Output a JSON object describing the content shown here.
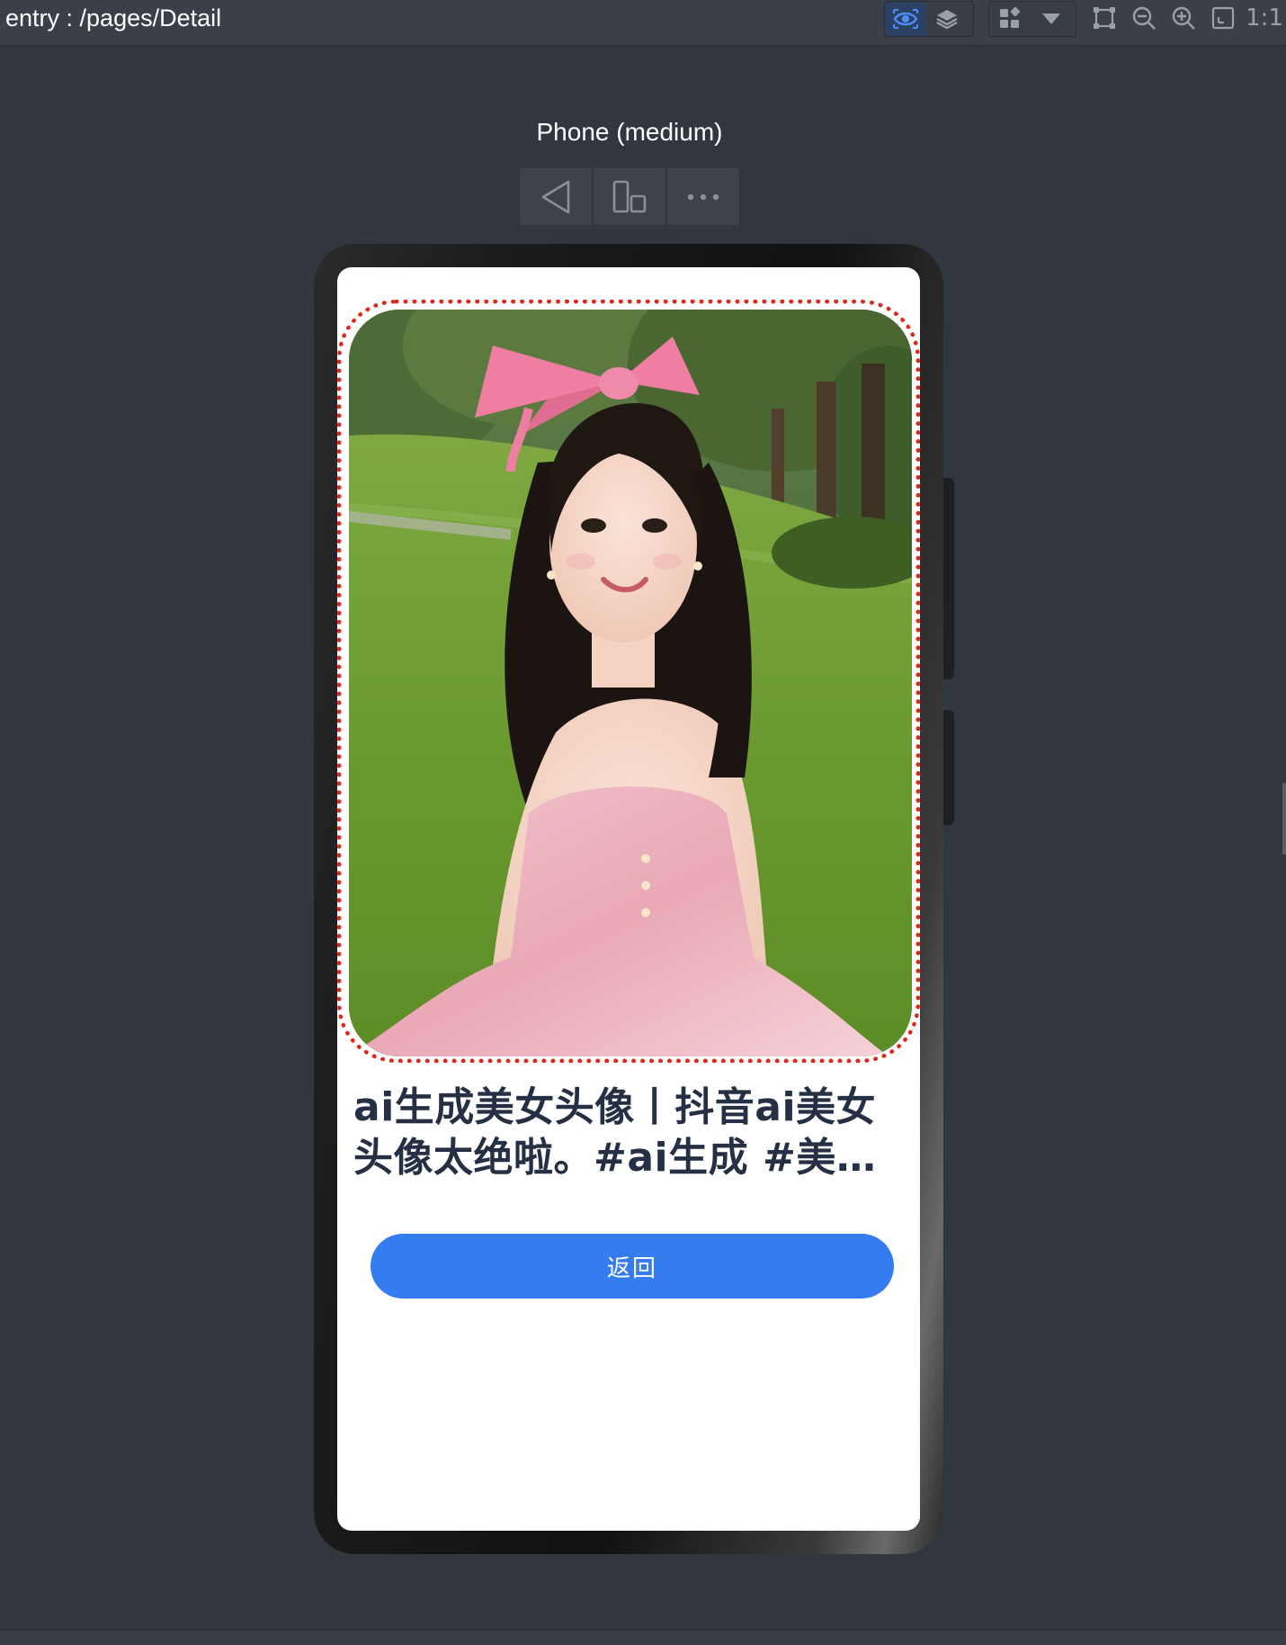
{
  "toolbar": {
    "route": "entry : /pages/Detail",
    "icons": [
      "inspector-eye-icon",
      "layers-icon",
      "component-grid-icon",
      "dropdown-arrow-icon",
      "bounds-icon",
      "zoom-out-icon",
      "zoom-in-icon",
      "fit-screen-icon"
    ],
    "ratio_label": "1:1"
  },
  "device": {
    "name": "Phone (medium)",
    "controls": [
      "back-triangle-icon",
      "rotate-device-icon",
      "more-icon"
    ]
  },
  "screen": {
    "title": "ai生成美女头像丨抖音ai美女头像太绝啦。#ai生成 #美女头像 #抖音",
    "back_button": "返回",
    "photo": "photo-of-girl-in-pink-floral-dress-with-pink-bow-on-lawn"
  },
  "colors": {
    "ide_background": "#32363f",
    "toolbar_background": "#3b3f47",
    "button_blue": "#357cf0",
    "dotted_border_red": "#e0271c",
    "title_text": "#263044"
  }
}
